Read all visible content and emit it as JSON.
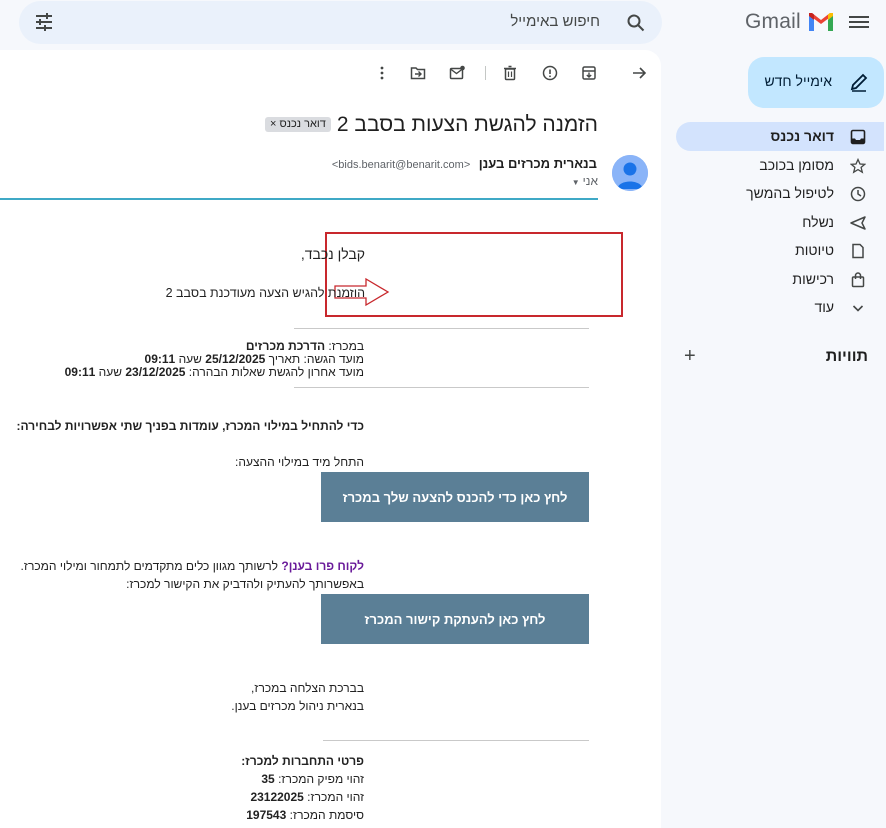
{
  "app": {
    "name": "Gmail"
  },
  "search": {
    "placeholder": "חיפוש באימייל"
  },
  "sidebar": {
    "compose_label": "אימייל חדש",
    "items": [
      {
        "label": "דואר נכנס",
        "icon": "inbox-icon",
        "active": true
      },
      {
        "label": "מסומן בכוכב",
        "icon": "star-icon"
      },
      {
        "label": "לטיפול בהמשך",
        "icon": "clock-icon"
      },
      {
        "label": "נשלח",
        "icon": "send-icon"
      },
      {
        "label": "טיוטות",
        "icon": "draft-icon"
      },
      {
        "label": "רכישות",
        "icon": "shopping-bag-icon"
      },
      {
        "label": "עוד",
        "icon": "chevron-down-icon"
      }
    ],
    "labels_heading": "תוויות",
    "labels_add": "+"
  },
  "message": {
    "subject": "הזמנה להגשת הצעות בסבב 2",
    "tag": "דואר נכנס ×",
    "sender_name": "בנארית מכרזים בענן",
    "sender_email": "<bids.benarit@benarit.com>",
    "to": "אני",
    "caret": "▼"
  },
  "email_body": {
    "greeting": "קבלן נכבד,",
    "invite": "הוזמנת להגיש הצעה מעודכנת בסבב 2",
    "tender_label": "במכרז:",
    "tender_name": "הדרכת מכרזים",
    "submit_label": "מועד הגשה: תאריך",
    "submit_date": "25/12/2025",
    "submit_time_label": "שעה",
    "submit_time": "09:11",
    "questions_label": "מועד אחרון להגשת שאלות הבהרה:",
    "questions_date": "23/12/2025",
    "questions_time_label": "שעה",
    "questions_time": "09:11",
    "options_intro": "כדי להתחיל במילוי המכרז, עומדות בפניך שתי אפשרויות לבחירה:",
    "start_now": "התחל מיד במילוי ההצעה:",
    "button1": "לחץ כאן כדי להכנס להצעה שלך במכרז",
    "pro_customer": "לקוח פרו בענן?",
    "pro_text": " לרשותך מגוון כלים מתקדמים לתמחור ומילוי המכרז.",
    "copy_text": "באפשרותך להעתיק ולהדביק את הקישור למכרז:",
    "button2": "לחץ כאן להעתקת קישור המכרז",
    "closing1": "בברכת הצלחה במכרז,",
    "closing2": "בנארית ניהול מכרזים בענן.",
    "connection_heading": "פרטי התחברות למכרז:",
    "issuer_label": "זהוי מפיק המכרז:",
    "issuer_id": "35",
    "tender_id_label": "זהוי המכרז:",
    "tender_id": "23122025",
    "password_label": "סיסמת המכרז:",
    "password": "197543"
  }
}
